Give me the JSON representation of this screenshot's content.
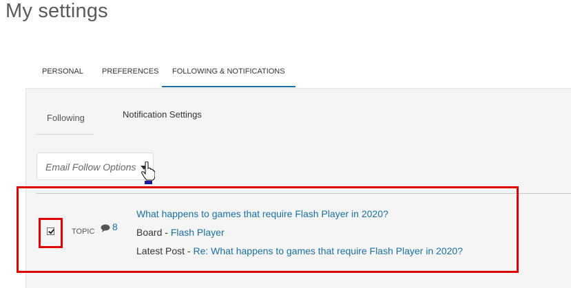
{
  "page": {
    "title": "My settings"
  },
  "tabs": [
    {
      "label": "PERSONAL"
    },
    {
      "label": "PREFERENCES"
    },
    {
      "label": "FOLLOWING & NOTIFICATIONS"
    }
  ],
  "subtabs": {
    "following": "Following",
    "notification_settings": "Notification Settings"
  },
  "email_follow": {
    "label": "Email Follow Options"
  },
  "followed_item": {
    "checked": true,
    "type_label": "TOPIC",
    "comment_count": "8",
    "title": "What happens to games that require Flash Player in 2020?",
    "board_prefix": "Board - ",
    "board_name": "Flash Player",
    "latest_prefix": "Latest Post - ",
    "latest_post": "Re: What happens to games that require Flash Player in 2020?"
  },
  "colors": {
    "link": "#1a6fa0",
    "highlight": "#e00000",
    "tab_underline": "#1a6fa0"
  },
  "icons": [
    "caret-down-icon",
    "hand-pointer-cursor-icon",
    "comment-icon",
    "checkmark-icon"
  ]
}
